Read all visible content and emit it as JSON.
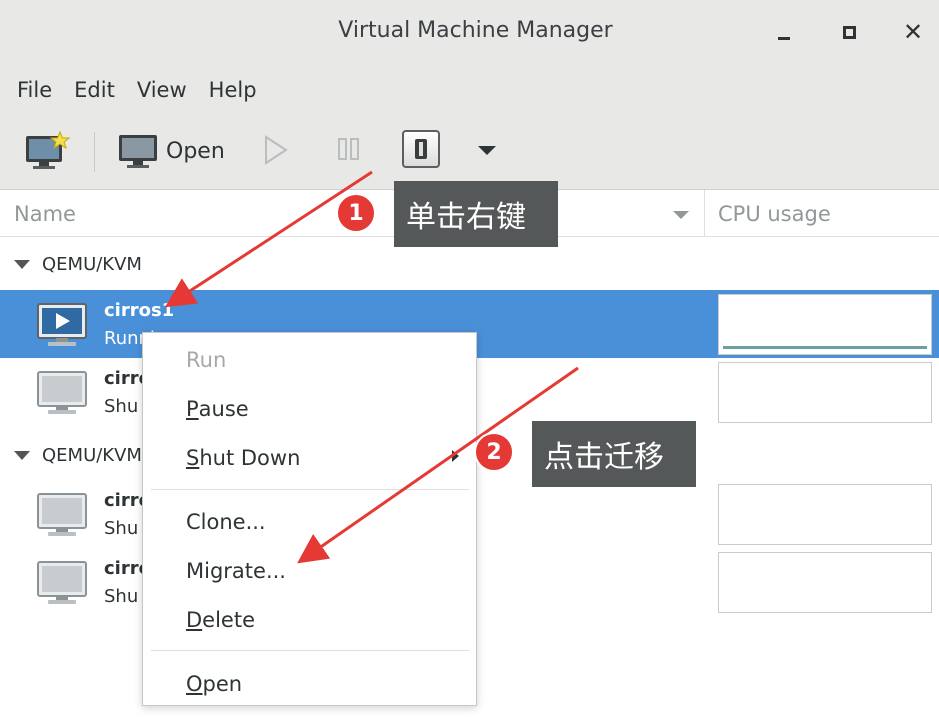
{
  "window": {
    "title": "Virtual Machine Manager"
  },
  "menubar": [
    "File",
    "Edit",
    "View",
    "Help"
  ],
  "toolbar": {
    "open_label": "Open",
    "icons": [
      "new-vm-icon",
      "monitor-icon",
      "play-icon",
      "pause-icon",
      "shutdown-icon",
      "dropdown-icon"
    ]
  },
  "columns": {
    "name": "Name",
    "cpu": "CPU usage"
  },
  "groups": [
    {
      "label": "QEMU/KVM"
    },
    {
      "label": "QEMU/KVM"
    }
  ],
  "vms": [
    {
      "name": "cirros1",
      "status": "Runni",
      "selected": true
    },
    {
      "name": "cirro",
      "status": "Shu",
      "selected": false
    },
    {
      "name": "cirro",
      "status": "Shu",
      "selected": false
    },
    {
      "name": "cirro",
      "status": "Shu",
      "selected": false
    }
  ],
  "context_menu": {
    "run": "Run",
    "pause_u": "P",
    "pause_rest": "ause",
    "shutdown_u": "S",
    "shutdown_rest": "hut Down",
    "clone": "Clone...",
    "migrate": "Migrate...",
    "delete_u": "D",
    "delete_rest": "elete",
    "open_u": "O",
    "open_rest": "pen"
  },
  "annotations": [
    {
      "number": "1",
      "text": "单击右键"
    },
    {
      "number": "2",
      "text": "点击迁移"
    }
  ],
  "colors": {
    "selection": "#4a90d9",
    "annotation_red": "#e53935",
    "callout_bg": "#555858"
  }
}
